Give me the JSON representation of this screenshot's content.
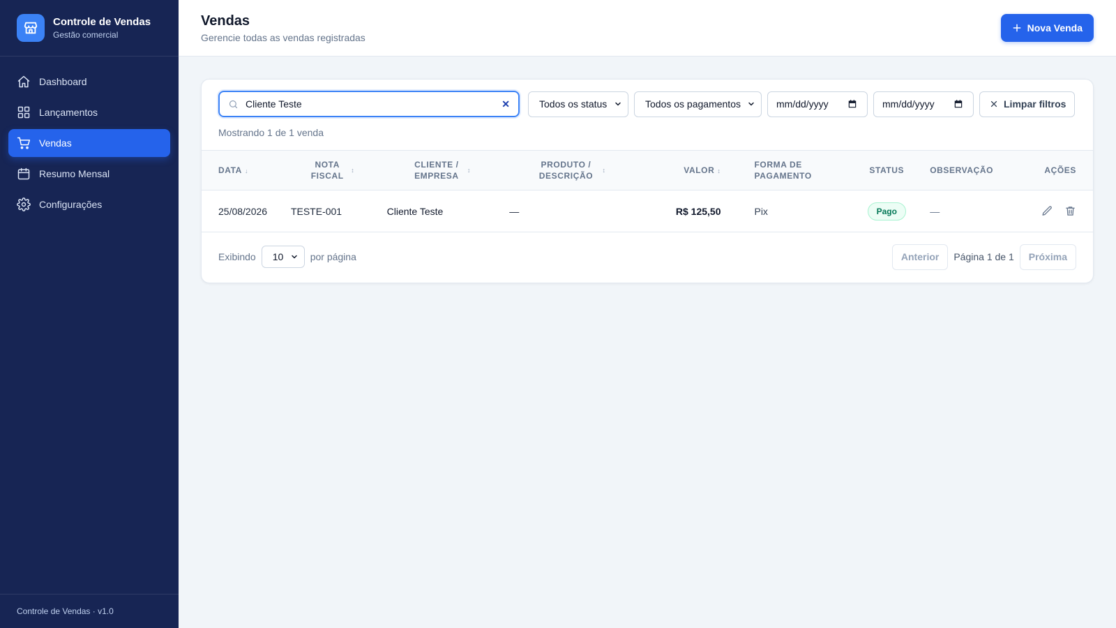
{
  "app": {
    "title": "Controle de Vendas",
    "subtitle": "Gestão comercial",
    "version_label": "Controle de Vendas · v1.0",
    "icon": "store-icon"
  },
  "nav": [
    {
      "label": "Dashboard",
      "icon": "home-icon",
      "active": false
    },
    {
      "label": "Lançamentos",
      "icon": "grid-icon",
      "active": false
    },
    {
      "label": "Vendas",
      "icon": "cart-icon",
      "active": true
    },
    {
      "label": "Resumo Mensal",
      "icon": "calendar-icon",
      "active": false
    },
    {
      "label": "Configurações",
      "icon": "gear-icon",
      "active": false
    }
  ],
  "header": {
    "title": "Vendas",
    "subtitle": "Gerencie todas as vendas registradas",
    "new_button": "Nova Venda"
  },
  "filters": {
    "search_value": "Cliente Teste",
    "status_select": "Todos os status",
    "payment_select": "Todos os pagamentos",
    "date_from": "mm/dd/yyyy",
    "date_to": "mm/dd/yyyy",
    "clear_button": "Limpar filtros"
  },
  "results_text": "Mostrando 1 de 1 venda",
  "table": {
    "columns": [
      "DATA",
      "NOTA FISCAL",
      "CLIENTE / EMPRESA",
      "PRODUTO / DESCRIÇÃO",
      "VALOR",
      "FORMA DE PAGAMENTO",
      "STATUS",
      "OBSERVAÇÃO",
      "AÇÕES"
    ],
    "rows": [
      {
        "data": "25/08/2026",
        "nota": "TESTE-001",
        "cliente": "Cliente Teste",
        "produto": "—",
        "valor": "R$ 125,50",
        "pagamento": "Pix",
        "status": "Pago",
        "observacao": "—"
      }
    ]
  },
  "pagination": {
    "showing_label": "Exibindo",
    "per_page_value": "10",
    "per_page_label": "por página",
    "prev": "Anterior",
    "page_info": "Página 1 de 1",
    "next": "Próxima"
  },
  "colors": {
    "sidebar_bg": "#172554",
    "accent": "#2563eb",
    "status_paid": "#047857"
  }
}
